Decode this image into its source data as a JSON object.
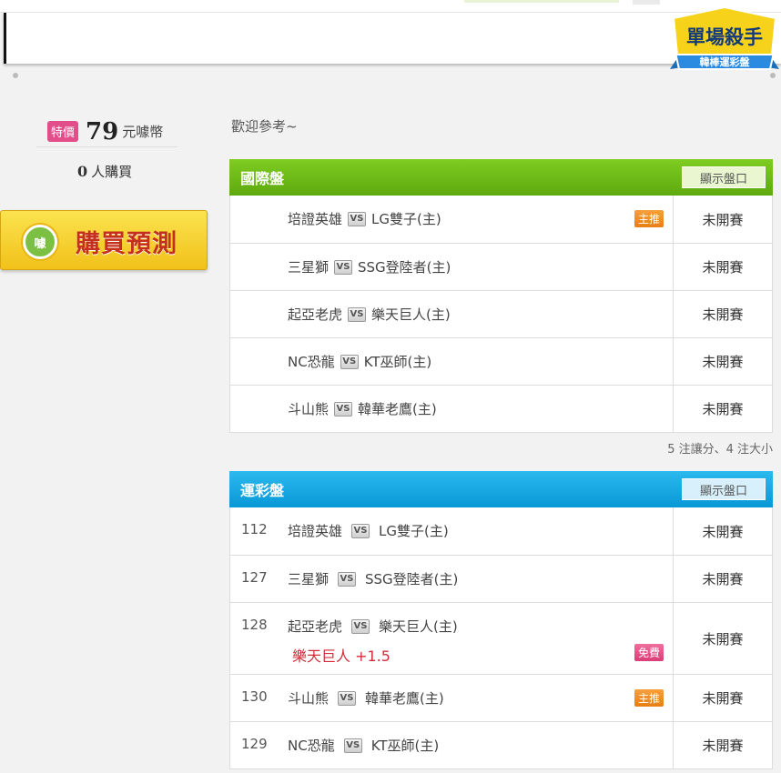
{
  "brand": {
    "logo_title": "單場殺手",
    "logo_subtitle": "韓棒運彩盤"
  },
  "sidebar": {
    "special_badge": "特價",
    "price": "79",
    "price_unit": "元噱幣",
    "buyer_count": "0",
    "buyer_label": "人購買",
    "buy_button_seal": "噱",
    "buy_button_label": "購買預測"
  },
  "main": {
    "welcome": "歡迎參考~"
  },
  "vs_label": "VS",
  "international": {
    "title": "國際盤",
    "show_button": "顯示盤口",
    "rows": [
      {
        "away": "培證英雄",
        "home": "LG雙子(主)",
        "tag": "主推",
        "status": "未開賽"
      },
      {
        "away": "三星獅",
        "home": "SSG登陸者(主)",
        "tag": "",
        "status": "未開賽"
      },
      {
        "away": "起亞老虎",
        "home": "樂天巨人(主)",
        "tag": "",
        "status": "未開賽"
      },
      {
        "away": "NC恐龍",
        "home": "KT巫師(主)",
        "tag": "",
        "status": "未開賽"
      },
      {
        "away": "斗山熊",
        "home": "韓華老鷹(主)",
        "tag": "",
        "status": "未開賽"
      }
    ],
    "note": "5 注讓分、4 注大小"
  },
  "sports_lottery": {
    "title": "運彩盤",
    "show_button": "顯示盤口",
    "rows": [
      {
        "num": "112",
        "away": "培證英雄",
        "home": "LG雙子(主)",
        "tag": "",
        "pick": "",
        "status": "未開賽"
      },
      {
        "num": "127",
        "away": "三星獅",
        "home": "SSG登陸者(主)",
        "tag": "",
        "pick": "",
        "status": "未開賽"
      },
      {
        "num": "128",
        "away": "起亞老虎",
        "home": "樂天巨人(主)",
        "tag": "免費",
        "pick": "樂天巨人 +1.5",
        "status": "未開賽"
      },
      {
        "num": "130",
        "away": "斗山熊",
        "home": "韓華老鷹(主)",
        "tag": "主推",
        "pick": "",
        "status": "未開賽"
      },
      {
        "num": "129",
        "away": "NC恐龍",
        "home": "KT巫師(主)",
        "tag": "",
        "pick": "",
        "status": "未開賽"
      }
    ]
  },
  "colors": {
    "green_header": "#6bb818",
    "blue_header": "#16a8e3",
    "pick_red": "#d12e3a",
    "tag_orange": "#ee8d22",
    "tag_pink": "#e24d8a"
  }
}
